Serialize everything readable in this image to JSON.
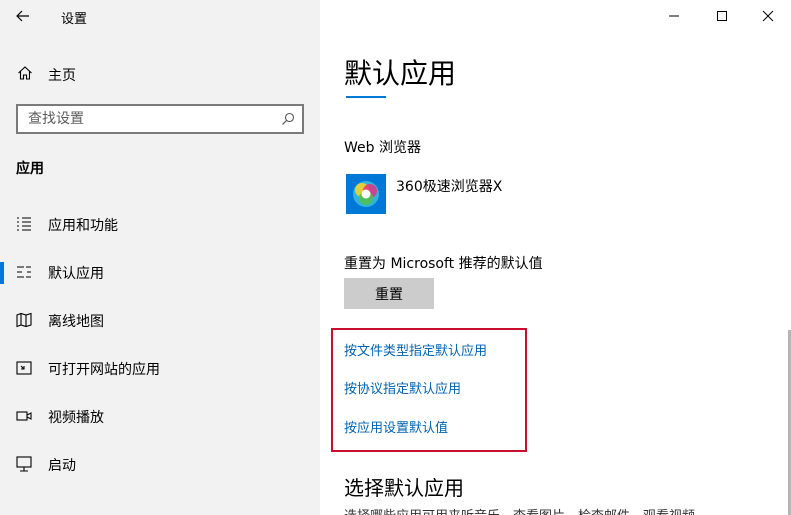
{
  "window": {
    "title": "设置",
    "minimize_icon": "minimize-icon",
    "maximize_icon": "maximize-icon",
    "close_icon": "close-icon"
  },
  "sidebar": {
    "home_label": "主页",
    "search_placeholder": "查找设置",
    "section_heading": "应用",
    "items": [
      {
        "label": "应用和功能",
        "icon": "list-icon",
        "active": false
      },
      {
        "label": "默认应用",
        "icon": "default-apps-icon",
        "active": true
      },
      {
        "label": "离线地图",
        "icon": "map-icon",
        "active": false
      },
      {
        "label": "可打开网站的应用",
        "icon": "open-web-icon",
        "active": false
      },
      {
        "label": "视频播放",
        "icon": "video-icon",
        "active": false
      },
      {
        "label": "启动",
        "icon": "startup-icon",
        "active": false
      }
    ]
  },
  "main": {
    "page_title": "默认应用",
    "web_browser_label": "Web 浏览器",
    "browser_name": "360极速浏览器X",
    "reset_label": "重置为 Microsoft 推荐的默认值",
    "reset_button": "重置",
    "links": [
      "按文件类型指定默认应用",
      "按协议指定默认应用",
      "按应用设置默认值"
    ],
    "choose_title": "选择默认应用",
    "choose_desc": "选择哪些应用可用来听音乐、查看图片、检查邮件、观看视频"
  },
  "colors": {
    "accent": "#0078d7",
    "link": "#0063b1",
    "highlight_box": "#c8102e",
    "sidebar_bg": "#f2f2f2"
  }
}
